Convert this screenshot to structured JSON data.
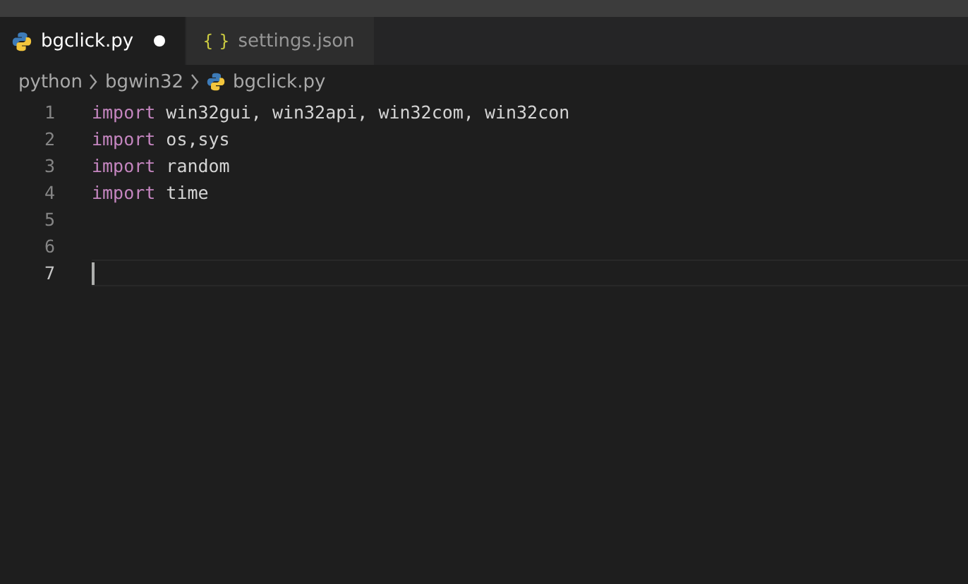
{
  "tabs": [
    {
      "label": "bgclick.py",
      "kind": "python",
      "selected": true,
      "modified": true
    },
    {
      "label": "settings.json",
      "kind": "json",
      "glyph": "{ }",
      "selected": false,
      "modified": false
    }
  ],
  "breadcrumb": [
    {
      "label": "python",
      "kind": "folder"
    },
    {
      "label": "bgwin32",
      "kind": "folder"
    },
    {
      "label": "bgclick.py",
      "kind": "python"
    }
  ],
  "editor": {
    "lines": [
      {
        "number": "1",
        "current": false,
        "tokens": [
          {
            "text": "import",
            "kind": "keyword"
          },
          {
            "text": " win32gui, win32api, win32com, win32con",
            "kind": "plain"
          }
        ]
      },
      {
        "number": "2",
        "current": false,
        "tokens": [
          {
            "text": "import",
            "kind": "keyword"
          },
          {
            "text": " os,sys",
            "kind": "plain"
          }
        ]
      },
      {
        "number": "3",
        "current": false,
        "tokens": [
          {
            "text": "import",
            "kind": "keyword"
          },
          {
            "text": " random",
            "kind": "plain"
          }
        ]
      },
      {
        "number": "4",
        "current": false,
        "tokens": [
          {
            "text": "import",
            "kind": "keyword"
          },
          {
            "text": " time",
            "kind": "plain"
          }
        ]
      },
      {
        "number": "5",
        "current": false
      },
      {
        "number": "6",
        "current": false
      },
      {
        "number": "7",
        "current": true
      }
    ]
  }
}
